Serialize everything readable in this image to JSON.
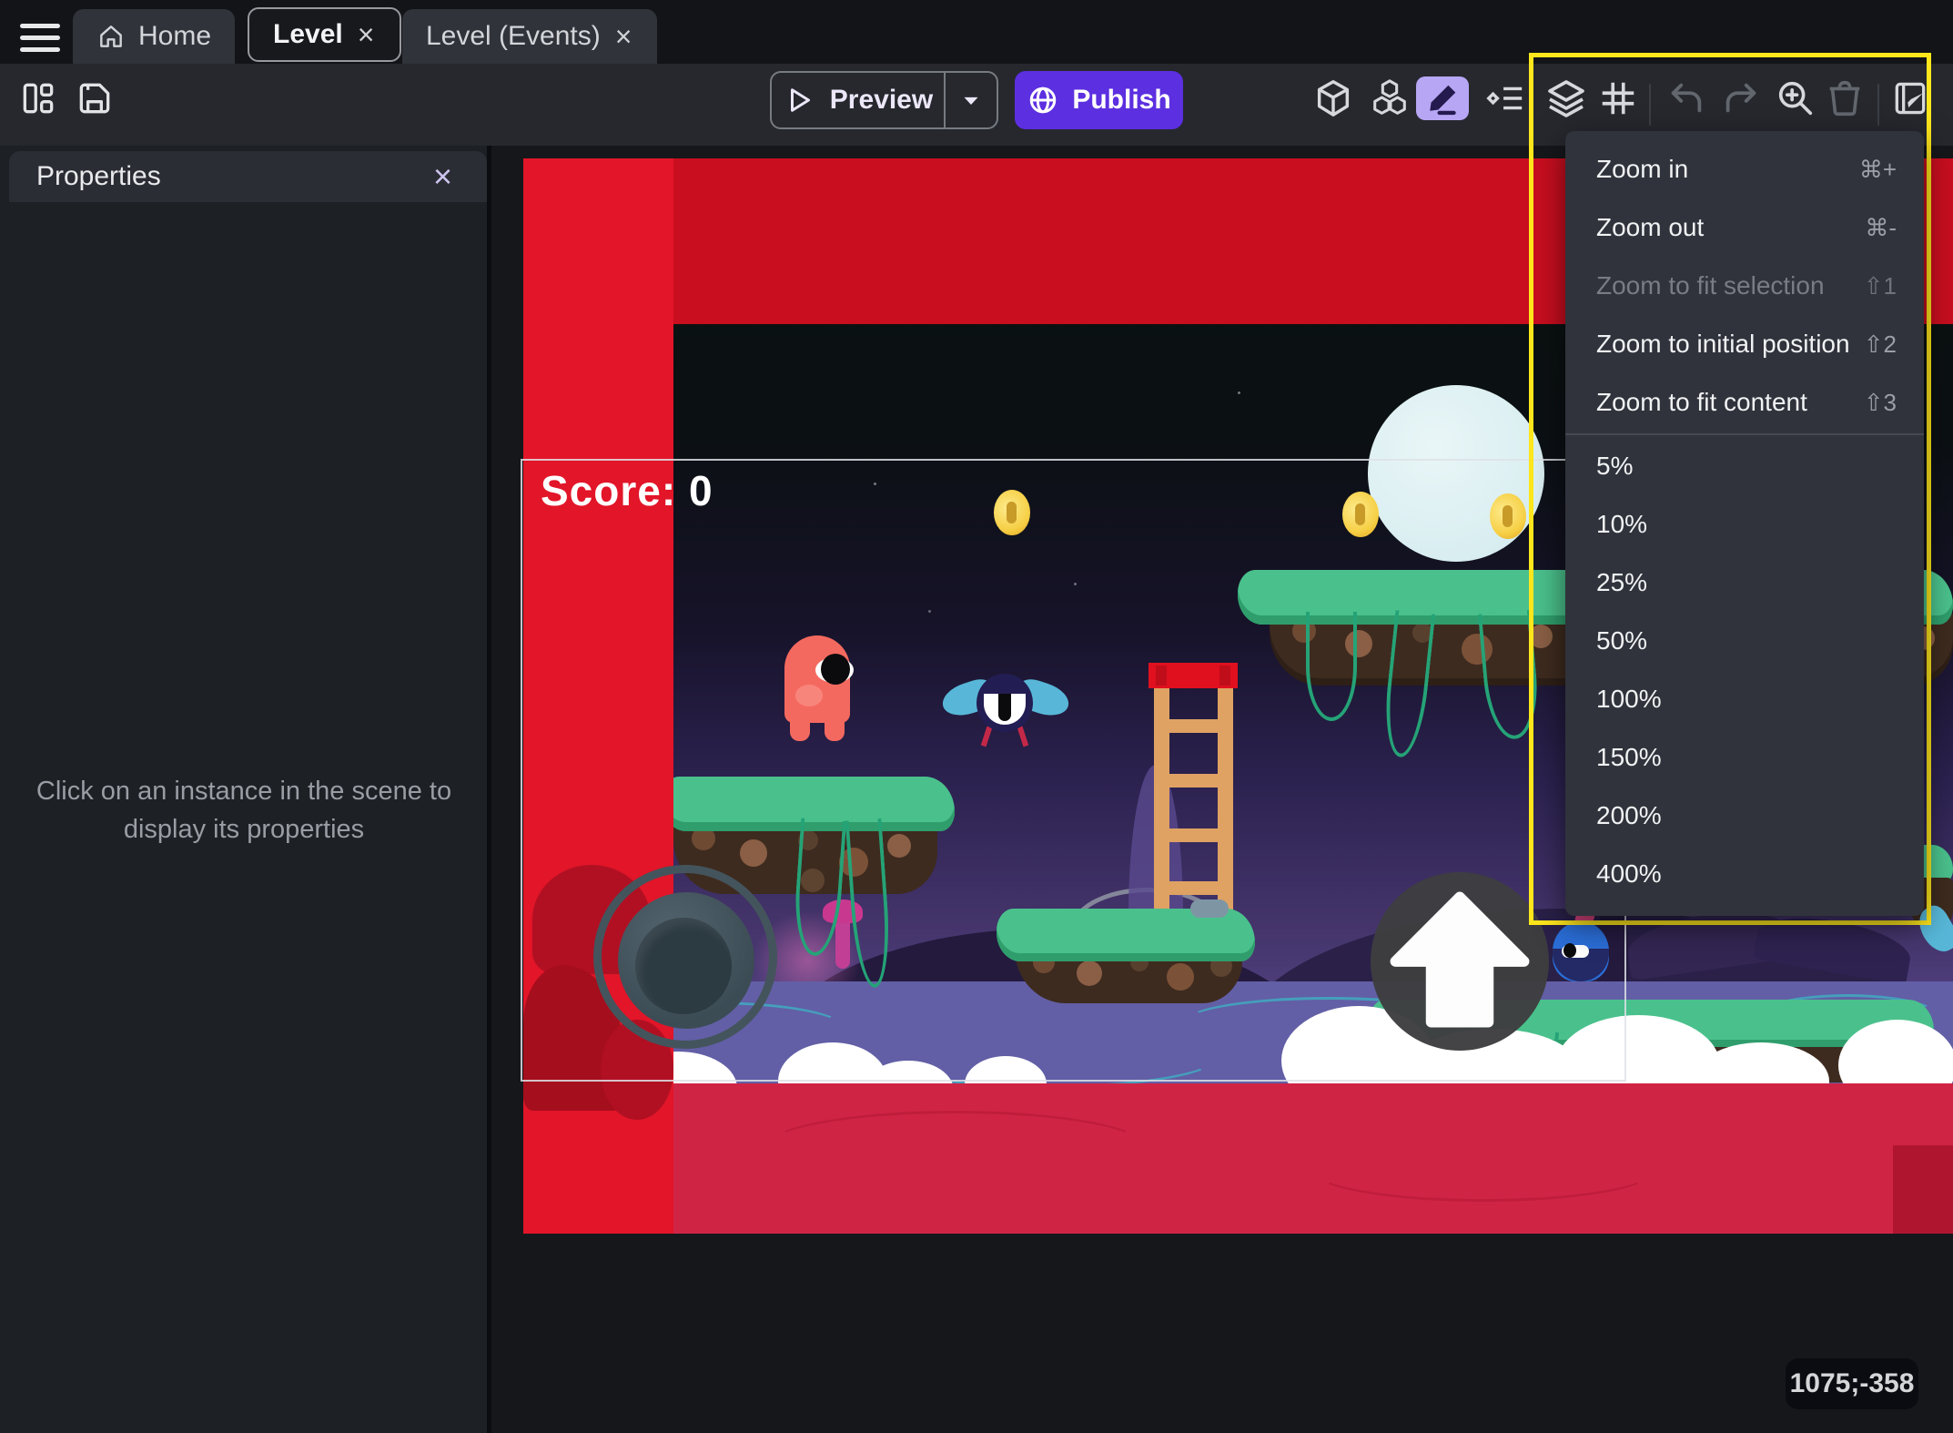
{
  "window": {
    "tabs": [
      {
        "label": "Home"
      },
      {
        "label": "Level",
        "close": "×"
      },
      {
        "label": "Level (Events)",
        "close": "×"
      }
    ]
  },
  "toolbar": {
    "preview_label": "Preview",
    "publish_label": "Publish",
    "icons": [
      "layout-columns",
      "save",
      "3d-box",
      "objects-cubes",
      "edit-pencil",
      "instances-list",
      "layers",
      "grid",
      "undo",
      "redo",
      "zoom-in",
      "trash",
      "edit-scene-properties"
    ]
  },
  "properties_panel": {
    "title": "Properties",
    "close": "×",
    "empty_hint": "Click on an instance in the scene to display its properties"
  },
  "scene": {
    "score_text": "Score: 0",
    "cursor_coordinates": "1075;-358"
  },
  "zoom_menu": {
    "items": [
      {
        "label": "Zoom in",
        "shortcut": "⌘+"
      },
      {
        "label": "Zoom out",
        "shortcut": "⌘-"
      },
      {
        "label": "Zoom to fit selection",
        "shortcut": "⇧1",
        "disabled": true
      },
      {
        "label": "Zoom to initial position",
        "shortcut": "⇧2"
      },
      {
        "label": "Zoom to fit content",
        "shortcut": "⇧3"
      }
    ],
    "zoom_levels": [
      "5%",
      "10%",
      "25%",
      "50%",
      "100%",
      "150%",
      "200%",
      "400%"
    ]
  },
  "colors": {
    "publish_button": "#5c2fe0",
    "selected_tool_bg": "#b7a6f4",
    "highlight_border": "#ffe71c",
    "scene_top_band": "#c80e1f",
    "scene_left_band": "#e21529",
    "scene_bottom_band": "#d02445",
    "menu_bg": "#30333b"
  }
}
